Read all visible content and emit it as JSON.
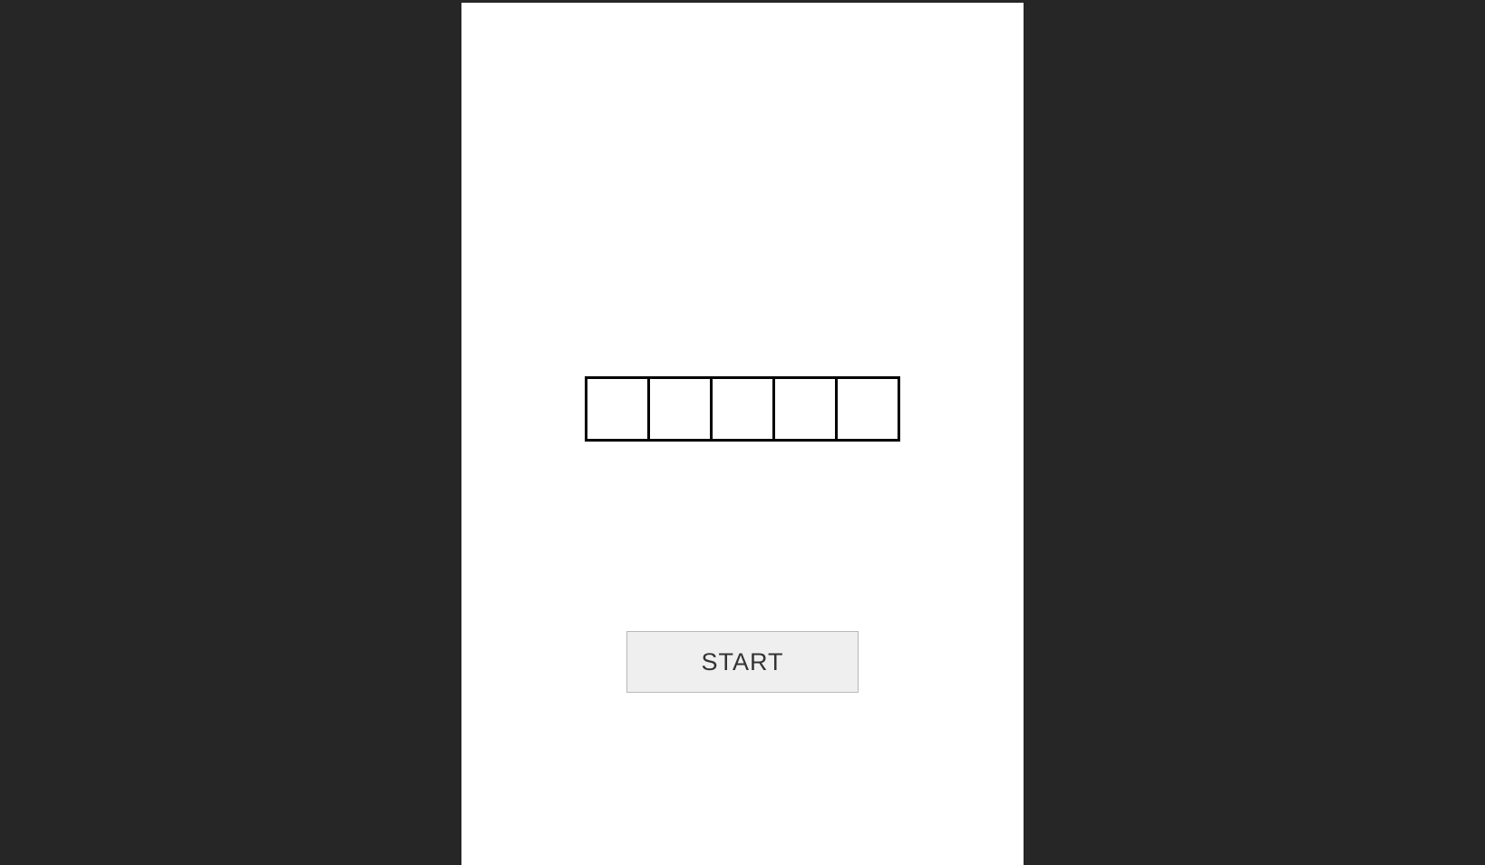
{
  "game": {
    "box_count": 5,
    "start_button_label": "START"
  }
}
